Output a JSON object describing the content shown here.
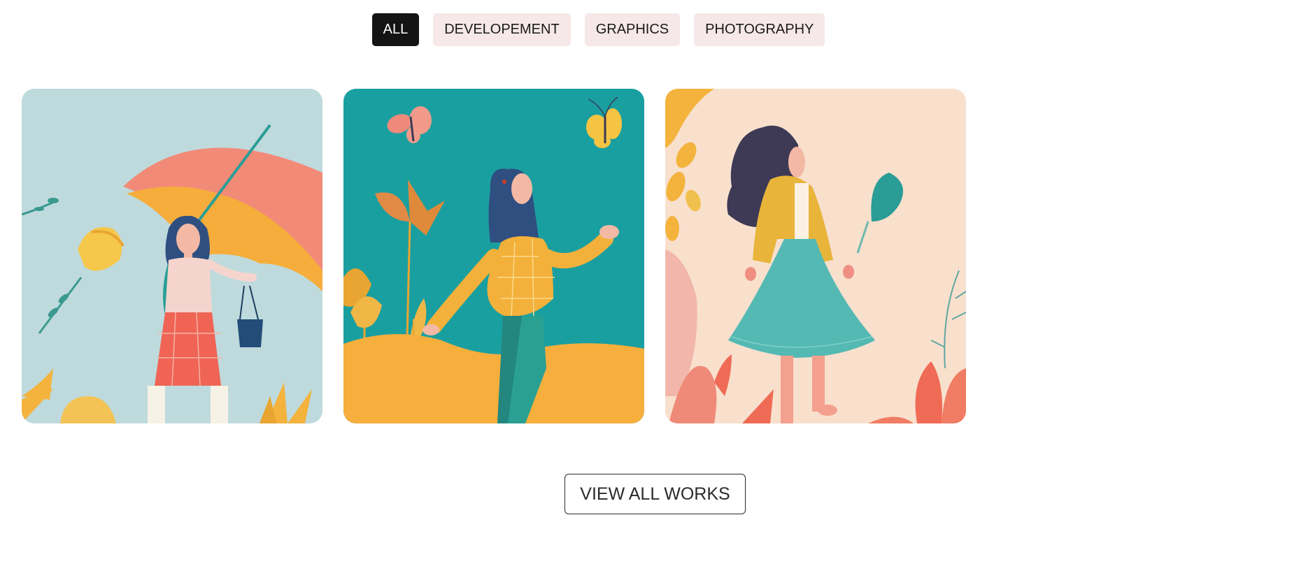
{
  "filters": [
    {
      "label": "ALL",
      "active": true
    },
    {
      "label": "DEVELOPEMENT",
      "active": false
    },
    {
      "label": "GRAPHICS",
      "active": false
    },
    {
      "label": "PHOTOGRAPHY",
      "active": false
    }
  ],
  "gallery": {
    "items": [
      {
        "illustration": "woman-with-umbrella",
        "background": "#bfdadd"
      },
      {
        "illustration": "woman-with-butterflies",
        "background": "#1a9fa0"
      },
      {
        "illustration": "woman-in-teal-skirt",
        "background": "#f8e0cd"
      }
    ]
  },
  "view_all_label": "VIEW ALL WORKS",
  "colors": {
    "active_filter_bg": "#141414",
    "filter_bg": "#f6e8e8",
    "accent_teal": "#2a9d96",
    "accent_yellow": "#f3b33d",
    "accent_coral": "#ef6b55"
  }
}
